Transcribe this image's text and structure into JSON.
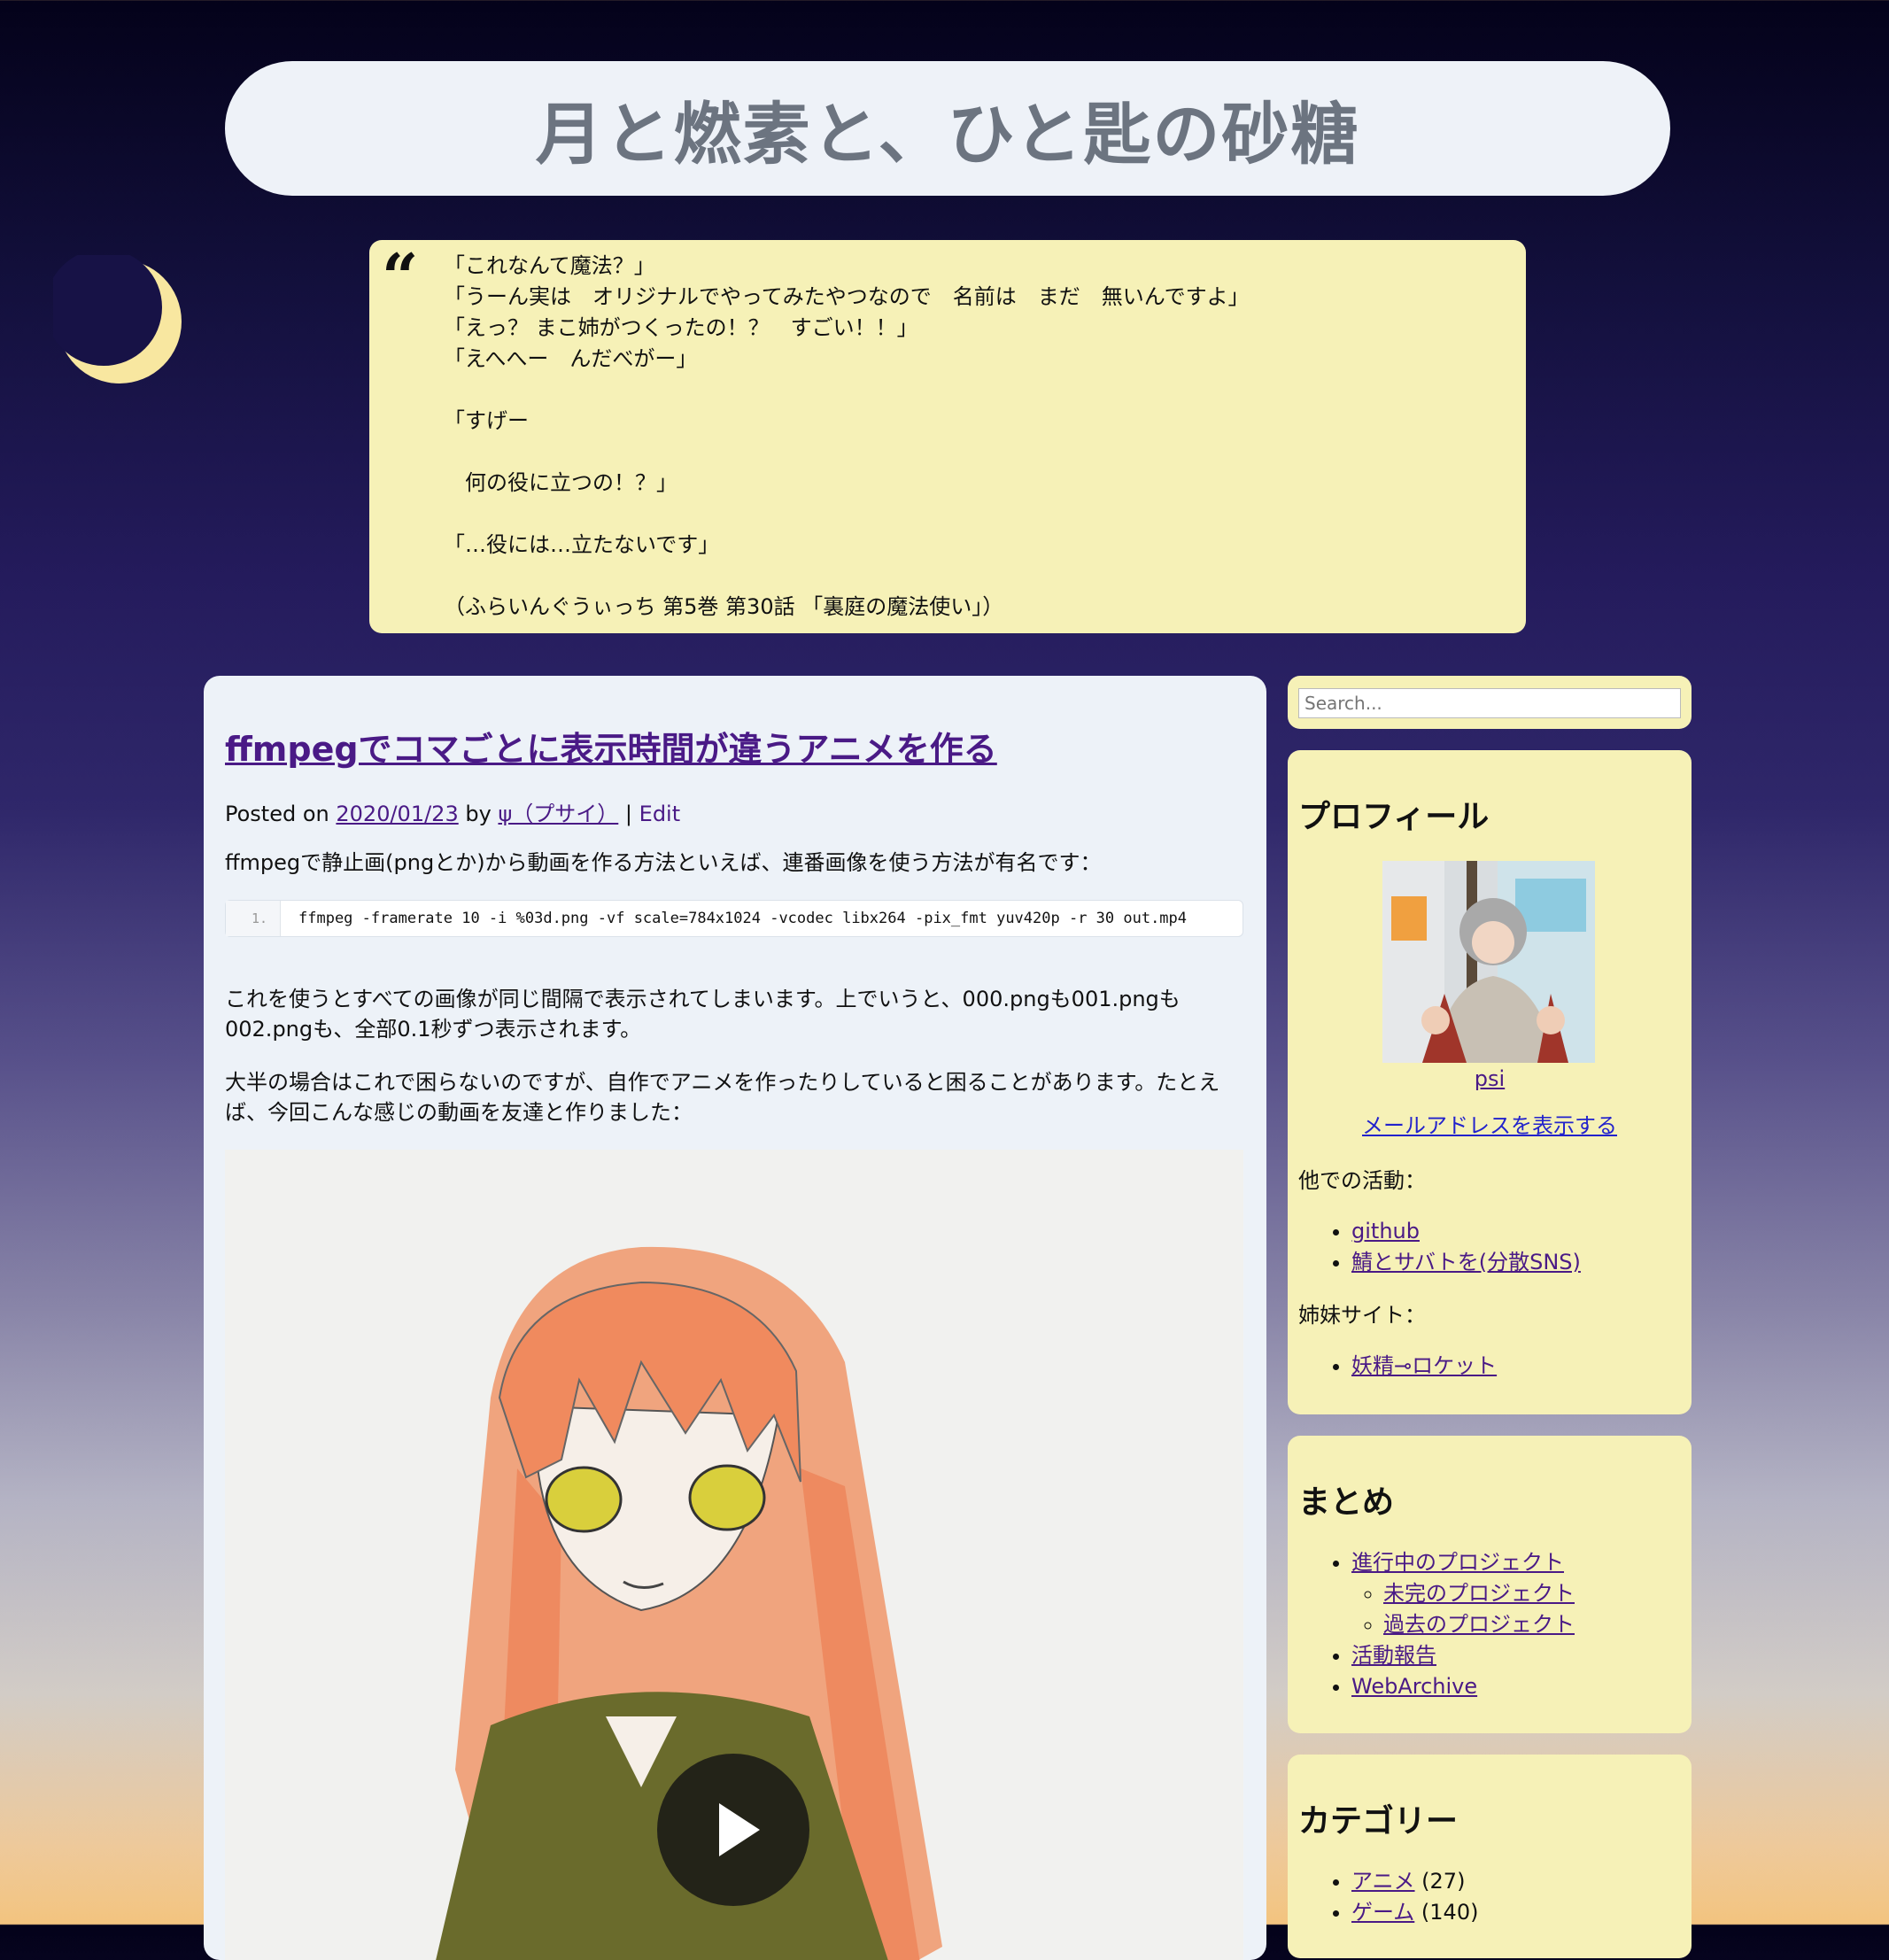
{
  "site": {
    "title": "月と燃素と、ひと匙の砂糖"
  },
  "quote": {
    "lines": [
      "「これなんて魔法？」",
      "「うーん実は　オリジナルでやってみたやつなので　名前は　まだ　無いんですよ」",
      "「えっ？ まこ姉がつくったの！？　すごい！！」",
      "「えへへー　んだべがー」",
      "",
      "「すげー",
      "",
      "　何の役に立つの！？」",
      "",
      "「…役には…立たないです」",
      "",
      "（ふらいんぐうぃっち 第5巻 第30話 「裏庭の魔法使い」）"
    ]
  },
  "post": {
    "title": "ffmpegでコマごとに表示時間が違うアニメを作る",
    "posted_on_label": "Posted on",
    "date": "2020/01/23",
    "by_label": "by",
    "author": "ψ（プサイ）",
    "separator": "|",
    "edit_label": "Edit",
    "para1": "ffmpegで静止画(pngとか)から動画を作る方法といえば、連番画像を使う方法が有名です：",
    "code_line_no": "1.",
    "code": "ffmpeg -framerate 10 -i %03d.png -vf scale=784x1024 -vcodec libx264 -pix_fmt yuv420p -r 30 out.mp4",
    "para2": "これを使うとすべての画像が同じ間隔で表示されてしまいます。上でいうと、000.pngも001.pngも002.pngも、全部0.1秒ずつ表示されます。",
    "para3": "大半の場合はこれで困らないのですが、自作でアニメを作ったりしていると困ることがあります。たとえば、今回こんな感じの動画を友達と作りました："
  },
  "sidebar": {
    "search_placeholder": "Search...",
    "profile": {
      "heading": "プロフィール",
      "name": "psi",
      "email_link": "メールアドレスを表示する",
      "activities_label": "他での活動：",
      "activities": [
        "github",
        "鯖とサバトを(分散SNS)"
      ],
      "sister_label": "姉妹サイト：",
      "sister_sites": [
        "妖精⊸ロケット"
      ]
    },
    "summary": {
      "heading": "まとめ",
      "item1": "進行中のプロジェクト",
      "sub1": "未完のプロジェクト",
      "sub2": "過去のプロジェクト",
      "item2": "活動報告",
      "item3": "WebArchive"
    },
    "categories": {
      "heading": "カテゴリー",
      "items": [
        {
          "name": "アニメ",
          "count": "(27)"
        },
        {
          "name": "ゲーム",
          "count": "(140)"
        }
      ]
    }
  },
  "colors": {
    "quote_bg": "#f6f1b7",
    "panel_bg": "#edf2f8",
    "link": "#4a1a86",
    "moon": "#f8e7a0"
  }
}
